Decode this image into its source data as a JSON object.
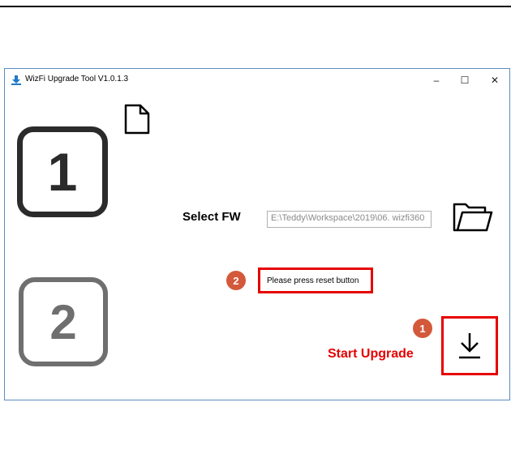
{
  "window": {
    "title": "WizFi Upgrade Tool V1.0.1.3",
    "controls": {
      "minimize": "–",
      "maximize": "☐",
      "close": "✕"
    }
  },
  "steps": {
    "one": "1",
    "two": "2"
  },
  "firmware": {
    "select_label": "Select FW",
    "path_value": "E:\\Teddy\\Workspace\\2019\\06. wizfi360"
  },
  "status": {
    "message": "Please press reset button"
  },
  "annotations": {
    "badge_reset": "2",
    "badge_start": "1"
  },
  "upgrade": {
    "start_label": "Start Upgrade"
  },
  "icons": [
    "app-icon",
    "file-icon",
    "folder-open-icon",
    "download-arrow-icon"
  ],
  "colors": {
    "highlight": "#e60000",
    "badge": "#d3593a",
    "window_border": "#5b8cc4"
  }
}
